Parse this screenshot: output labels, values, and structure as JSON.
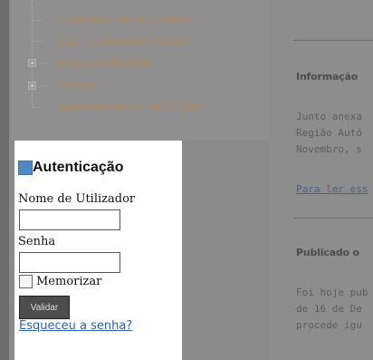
{
  "tree": {
    "items": [
      {
        "label": "Engenharia \"no seu melhor\""
      },
      {
        "label": "Eng. no seu melhor (video)"
      },
      {
        "label": "Eleição ANET-2008",
        "expander": "+"
      },
      {
        "label": "Eventos",
        "expander": "+"
      },
      {
        "label": "Questões sobre a Lei 31/2009"
      }
    ]
  },
  "articles": {
    "first_title": "Informação",
    "first_lines": [
      "Junto anexa",
      "Região Autó",
      "Novembro, s"
    ],
    "first_link": "Para ler ess",
    "second_title": "Publicado o",
    "second_lines": [
      "Foi hoje pub",
      "de 16 de De",
      "procede igu"
    ]
  },
  "auth": {
    "title": "Autenticação",
    "username_label": "Nome de Utilizador",
    "password_label": "Senha",
    "remember_label": "Memorizar",
    "submit_label": "Validar",
    "forgot_link": "Esqueceu a senha?"
  }
}
